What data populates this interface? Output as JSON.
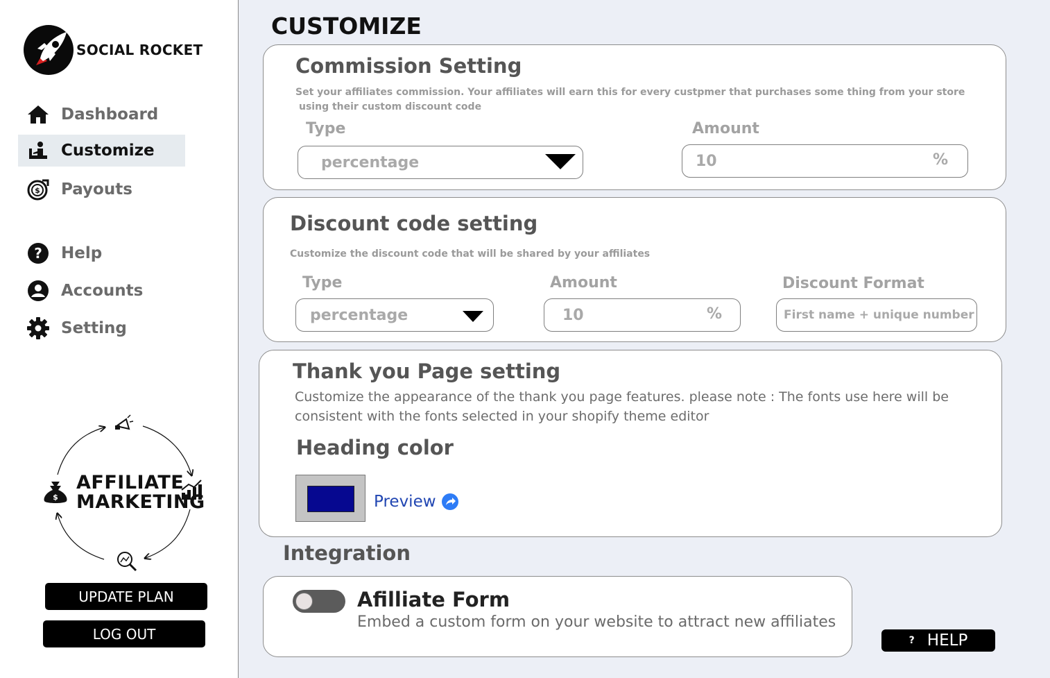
{
  "brand": {
    "name": "SOCIAL ROCKET"
  },
  "sidebar": {
    "items": [
      {
        "label": "Dashboard",
        "icon": "home-icon"
      },
      {
        "label": "Customize",
        "icon": "customize-icon",
        "active": true
      },
      {
        "label": "Payouts",
        "icon": "payouts-icon"
      },
      {
        "label": "Help",
        "icon": "help-icon"
      },
      {
        "label": "Accounts",
        "icon": "account-icon"
      },
      {
        "label": "Setting",
        "icon": "gear-icon"
      }
    ],
    "graphic": {
      "line1": "AFFILIATE",
      "line2": "MARKETING"
    },
    "update_plan_label": "UPDATE PLAN",
    "logout_label": "LOG OUT"
  },
  "main": {
    "title": "CUSTOMIZE",
    "commission": {
      "title": "Commission Setting",
      "desc_line1": "Set your affiliates commission. Your affiliates will earn this for every custpmer that purchases some thing from your store",
      "desc_line2": "using their custom discount code",
      "type_label": "Type",
      "type_value": "percentage",
      "amount_label": "Amount",
      "amount_value": "10",
      "amount_suffix": "%"
    },
    "discount": {
      "title": "Discount code setting",
      "desc": "Customize the discount code that will be shared by your affiliates",
      "type_label": "Type",
      "type_value": "percentage",
      "amount_label": "Amount",
      "amount_value": "10",
      "amount_suffix": "%",
      "format_label": "Discount Format",
      "format_placeholder": "First name + unique number"
    },
    "thankyou": {
      "title": "Thank you Page setting",
      "desc_line1": "Customize the appearance of the thank you page features. please note : The fonts use here will be",
      "desc_line2": "consistent with the fonts selected in your shopify theme editor",
      "heading_color_label": "Heading color",
      "heading_color": "#060890",
      "preview_label": "Preview"
    },
    "integration": {
      "title": "Integration",
      "form_title": "Afilliate Form",
      "form_desc": "Embed a custom form on your website to attract new affiliates",
      "enabled": false
    },
    "help_label": "HELP"
  }
}
